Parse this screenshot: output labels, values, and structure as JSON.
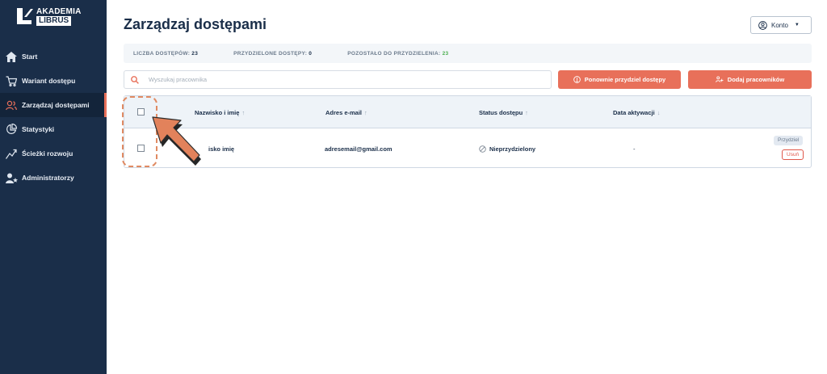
{
  "sidebar": {
    "logo": {
      "line1": "AKADEMIA",
      "line2": "LIBRUS"
    },
    "items": [
      {
        "label": "Start",
        "icon": "home-icon"
      },
      {
        "label": "Wariant dostępu",
        "icon": "cart-icon"
      },
      {
        "label": "Zarządzaj dostępami",
        "icon": "users-icon",
        "active": true
      },
      {
        "label": "Statystyki",
        "icon": "pie-chart-icon"
      },
      {
        "label": "Ścieżki rozwoju",
        "icon": "growth-path-icon"
      },
      {
        "label": "Administratorzy",
        "icon": "admin-users-icon"
      }
    ]
  },
  "header": {
    "title": "Zarządzaj dostępami",
    "account_label": "Konto"
  },
  "stats": {
    "total_label": "LICZBA DOSTĘPÓW:",
    "total_value": "23",
    "assigned_label": "PRZYDZIELONE DOSTĘPY:",
    "assigned_value": "0",
    "remaining_label": "POZOSTAŁO DO PRZYDZIELENIA:",
    "remaining_value": "23"
  },
  "search": {
    "placeholder": "Wyszukaj pracownika"
  },
  "actions": {
    "reassign_label": "Ponownie przydziel dostępy",
    "add_label": "Dodaj pracowników"
  },
  "table": {
    "columns": [
      "Nazwisko i imię",
      "Adres e-mail",
      "Status dostępu",
      "Data aktywacji"
    ],
    "rows": [
      {
        "name": "isko imię",
        "email": "adresemail@gmail.com",
        "status": "Nieprzydzielony",
        "date": "-",
        "assign_label": "Przydziel",
        "remove_label": "Usuń"
      }
    ]
  },
  "colors": {
    "sidebar_bg": "#1a2e49",
    "accent": "#e8705a",
    "remaining_value": "#4caf50",
    "annotation": "#e08a62"
  }
}
